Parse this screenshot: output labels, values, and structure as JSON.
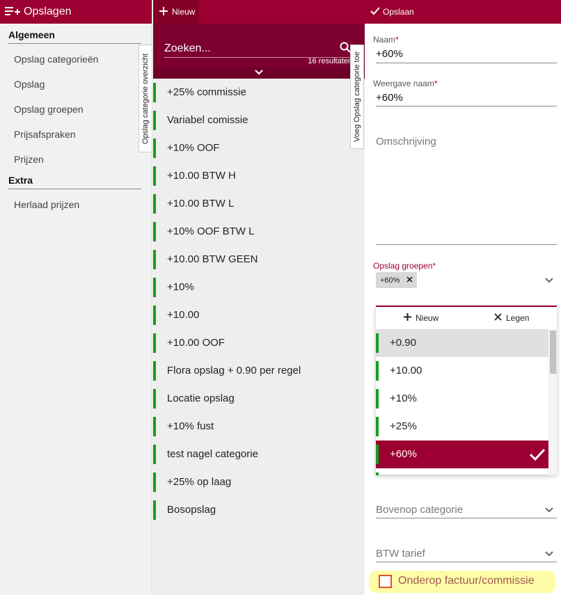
{
  "nav": {
    "title": "Opslagen",
    "sections": [
      {
        "title": "Algemeen",
        "items": [
          "Opslag categorieën",
          "Opslag",
          "Opslag groepen",
          "Prijsafspraken",
          "Prijzen"
        ]
      },
      {
        "title": "Extra",
        "items": [
          "Herlaad prijzen"
        ]
      }
    ]
  },
  "list": {
    "new_label": "Nieuw",
    "search_placeholder": "Zoeken...",
    "result_count": "16 resultaten",
    "items": [
      "+25% commissie",
      "Variabel comissie",
      "+10% OOF",
      "+10.00 BTW H",
      "+10.00 BTW L",
      "+10% OOF BTW L",
      "+10.00 BTW GEEN",
      "+10%",
      "+10.00",
      "+10.00 OOF",
      "Flora opslag + 0.90 per regel",
      "Locatie opslag",
      "+10% fust",
      "test nagel categorie",
      "+25% op laag",
      "Bosopslag"
    ],
    "item_bar_color": "#1a9c1a"
  },
  "tabs": {
    "overview": "Opslag categorie overzicht",
    "add": "Voeg Opslag categorie toe"
  },
  "form": {
    "save_label": "Opslaan",
    "name_label": "Naam",
    "name_value": "+60%",
    "display_name_label": "Weergave naam",
    "display_name_value": "+60%",
    "description_placeholder": "Omschrijving",
    "groups_label": "Opslag groepen",
    "groups_chip": "+60%",
    "dropdown": {
      "new_label": "Nieuw",
      "clear_label": "Legen",
      "options": [
        "+0.90",
        "+10.00",
        "+10%",
        "+25%",
        "+60%"
      ],
      "hovered": "+0.90",
      "selected": "+60%"
    },
    "above_category_placeholder": "Bovenop categorie",
    "vat_placeholder": "BTW tarief",
    "invoice_checkbox_label": "Onderop factuur/commissie",
    "invoice_checkbox_checked": false
  },
  "colors": {
    "brand": "#9c0032",
    "search_bg": "#7d0030",
    "highlight": "#fffca8",
    "checkbox_border": "#e54d2e"
  }
}
